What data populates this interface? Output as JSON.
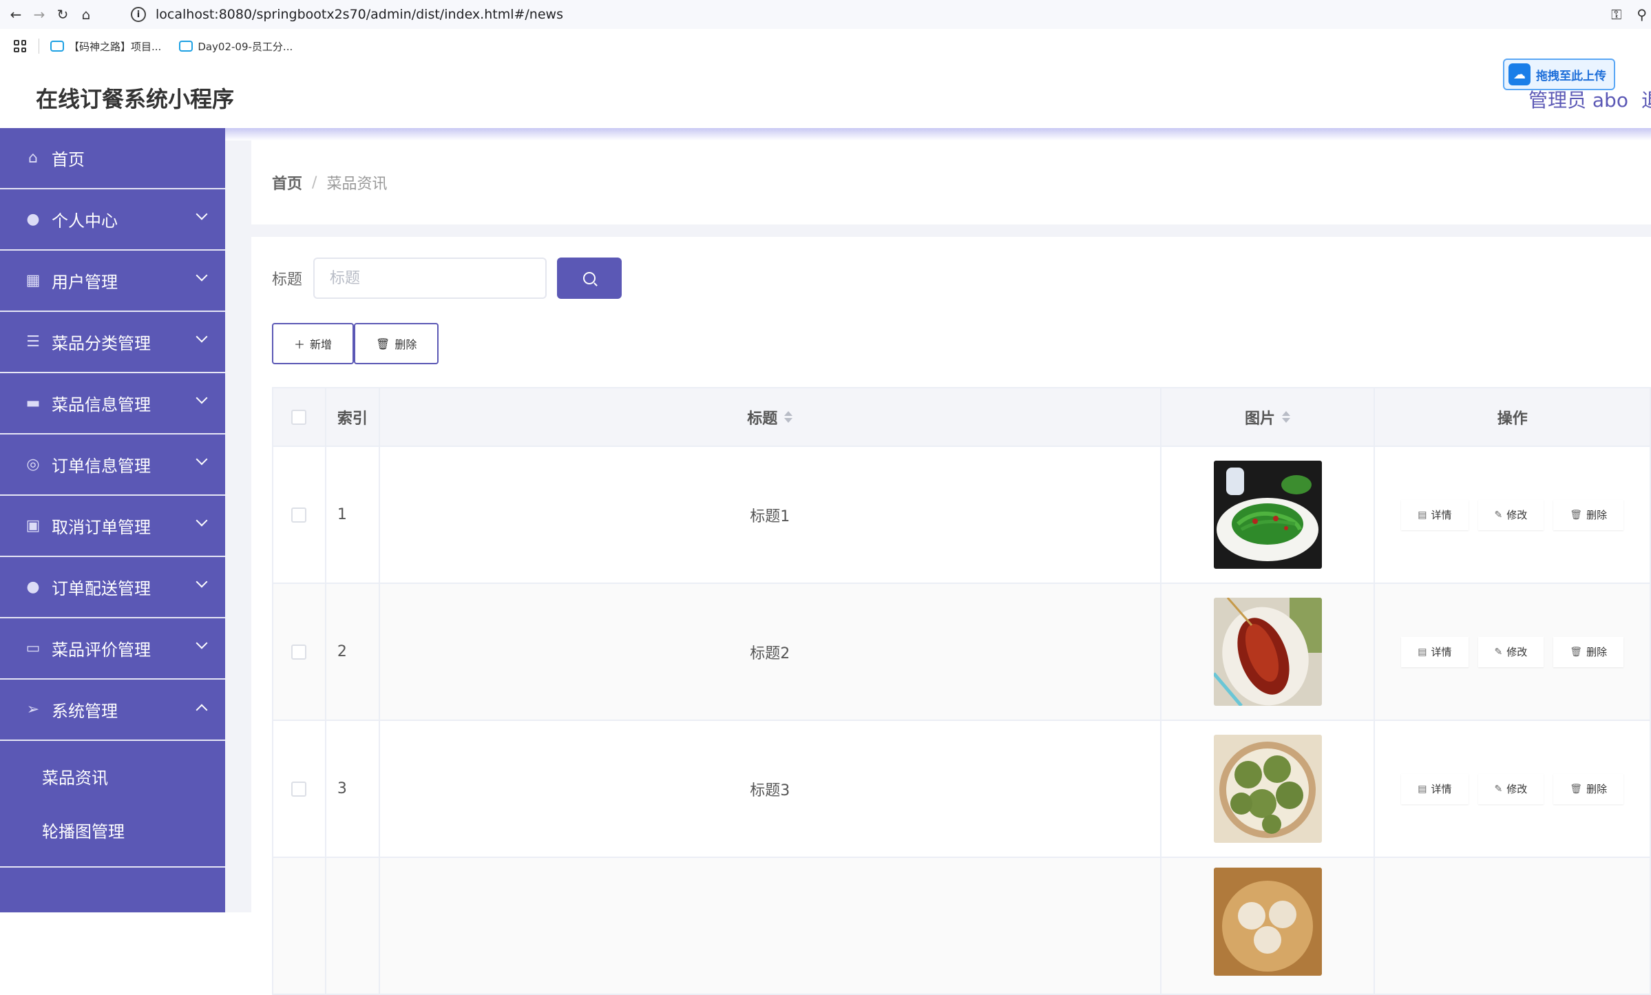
{
  "browser": {
    "url": "localhost:8080/springbootx2s70/admin/dist/index.html#/news",
    "bookmarks": [
      {
        "label": "【码神之路】项目..."
      },
      {
        "label": "Day02-09-员工分..."
      }
    ]
  },
  "header": {
    "app_title": "在线订餐系统小程序",
    "upload_badge": "拖拽至此上传",
    "admin_label": "管理员 abo",
    "logout_label": "退"
  },
  "sidebar": {
    "items": [
      {
        "label": "首页",
        "icon": "home-icon"
      },
      {
        "label": "个人中心",
        "icon": "user-icon"
      },
      {
        "label": "用户管理",
        "icon": "grid-icon"
      },
      {
        "label": "菜品分类管理",
        "icon": "list-icon"
      },
      {
        "label": "菜品信息管理",
        "icon": "brush-icon"
      },
      {
        "label": "订单信息管理",
        "icon": "lifebuoy-icon"
      },
      {
        "label": "取消订单管理",
        "icon": "clipboard-icon"
      },
      {
        "label": "订单配送管理",
        "icon": "person-icon"
      },
      {
        "label": "菜品评价管理",
        "icon": "monitor-icon"
      },
      {
        "label": "系统管理",
        "icon": "send-icon"
      }
    ],
    "submenu": [
      {
        "label": "菜品资讯"
      },
      {
        "label": "轮播图管理"
      }
    ]
  },
  "breadcrumb": {
    "home": "首页",
    "separator": "/",
    "current": "菜品资讯"
  },
  "search": {
    "label": "标题",
    "placeholder": "标题"
  },
  "actions": {
    "add_label": "新增",
    "delete_label": "删除"
  },
  "table": {
    "columns": {
      "index": "索引",
      "title": "标题",
      "picture": "图片",
      "operation": "操作"
    },
    "op_labels": {
      "detail": "详情",
      "edit": "修改",
      "delete": "删除"
    },
    "rows": [
      {
        "index": "1",
        "title": "标题1"
      },
      {
        "index": "2",
        "title": "标题2"
      },
      {
        "index": "3",
        "title": "标题3"
      },
      {
        "index": "",
        "title": ""
      }
    ]
  },
  "colors": {
    "primary": "#5b58b5",
    "sidebar_bg": "#5b58b5",
    "content_bg": "#f2f3f8"
  }
}
